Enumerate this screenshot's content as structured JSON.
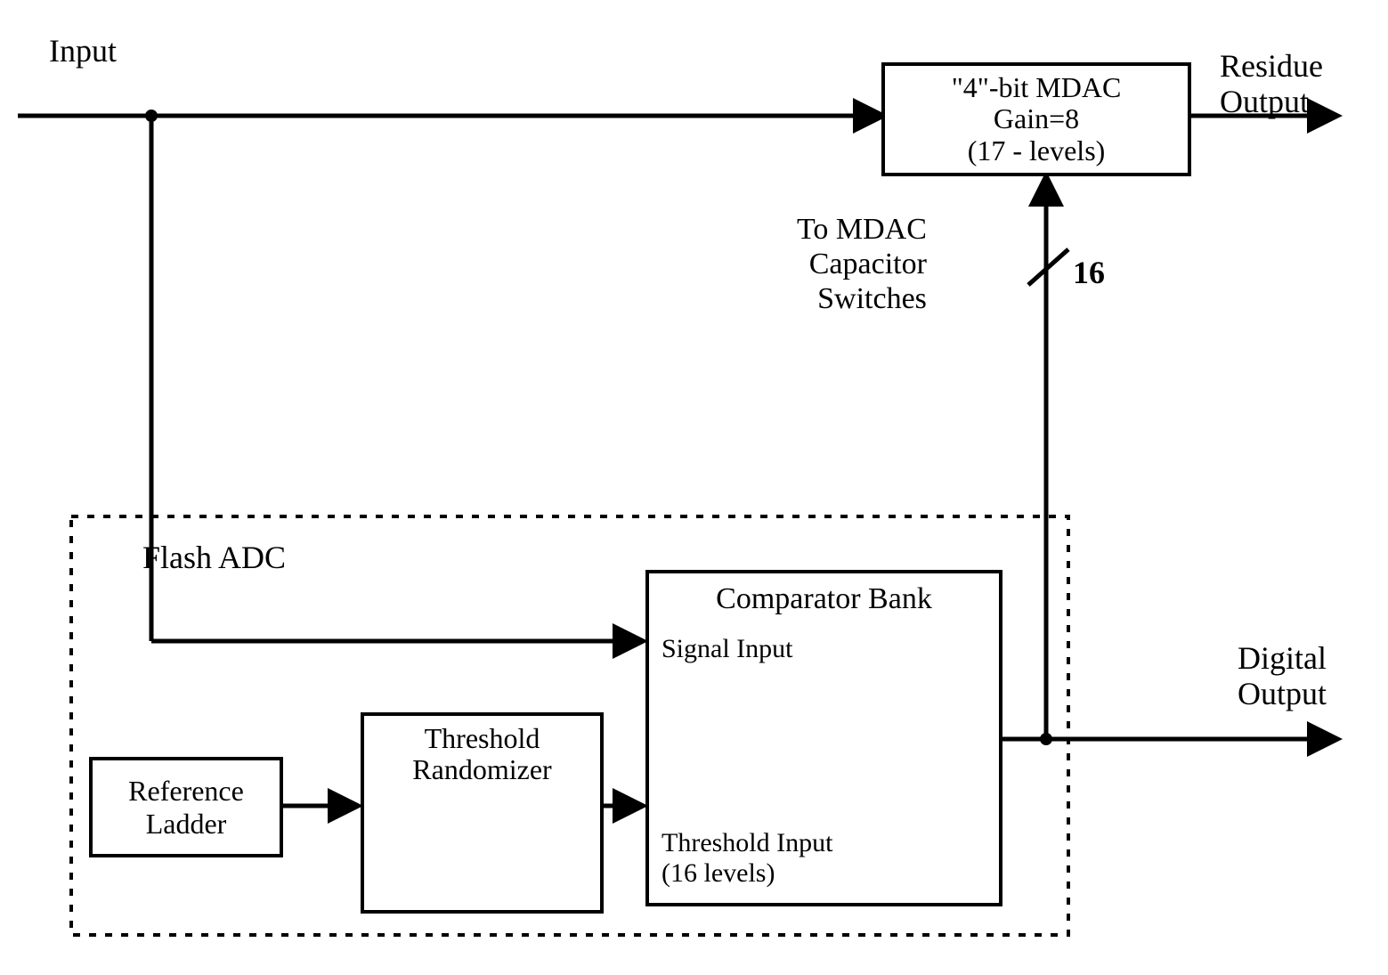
{
  "labels": {
    "input": "Input",
    "residue_output_l1": "Residue",
    "residue_output_l2": "Output",
    "digital_output_l1": "Digital",
    "digital_output_l2": "Output",
    "flash_adc": "Flash ADC",
    "to_mdac_l1": "To MDAC",
    "to_mdac_l2": "Capacitor",
    "to_mdac_l3": "Switches",
    "bus_width": "16"
  },
  "blocks": {
    "mdac_l1": "\"4\"-bit MDAC",
    "mdac_l2": "Gain=8",
    "mdac_l3": "(17 - levels)",
    "ref_ladder_l1": "Reference",
    "ref_ladder_l2": "Ladder",
    "randomizer_l1": "Threshold",
    "randomizer_l2": "Randomizer",
    "comp_title": "Comparator Bank",
    "comp_sig": "Signal Input",
    "comp_thr_l1": "Threshold Input",
    "comp_thr_l2": "(16 levels)"
  }
}
